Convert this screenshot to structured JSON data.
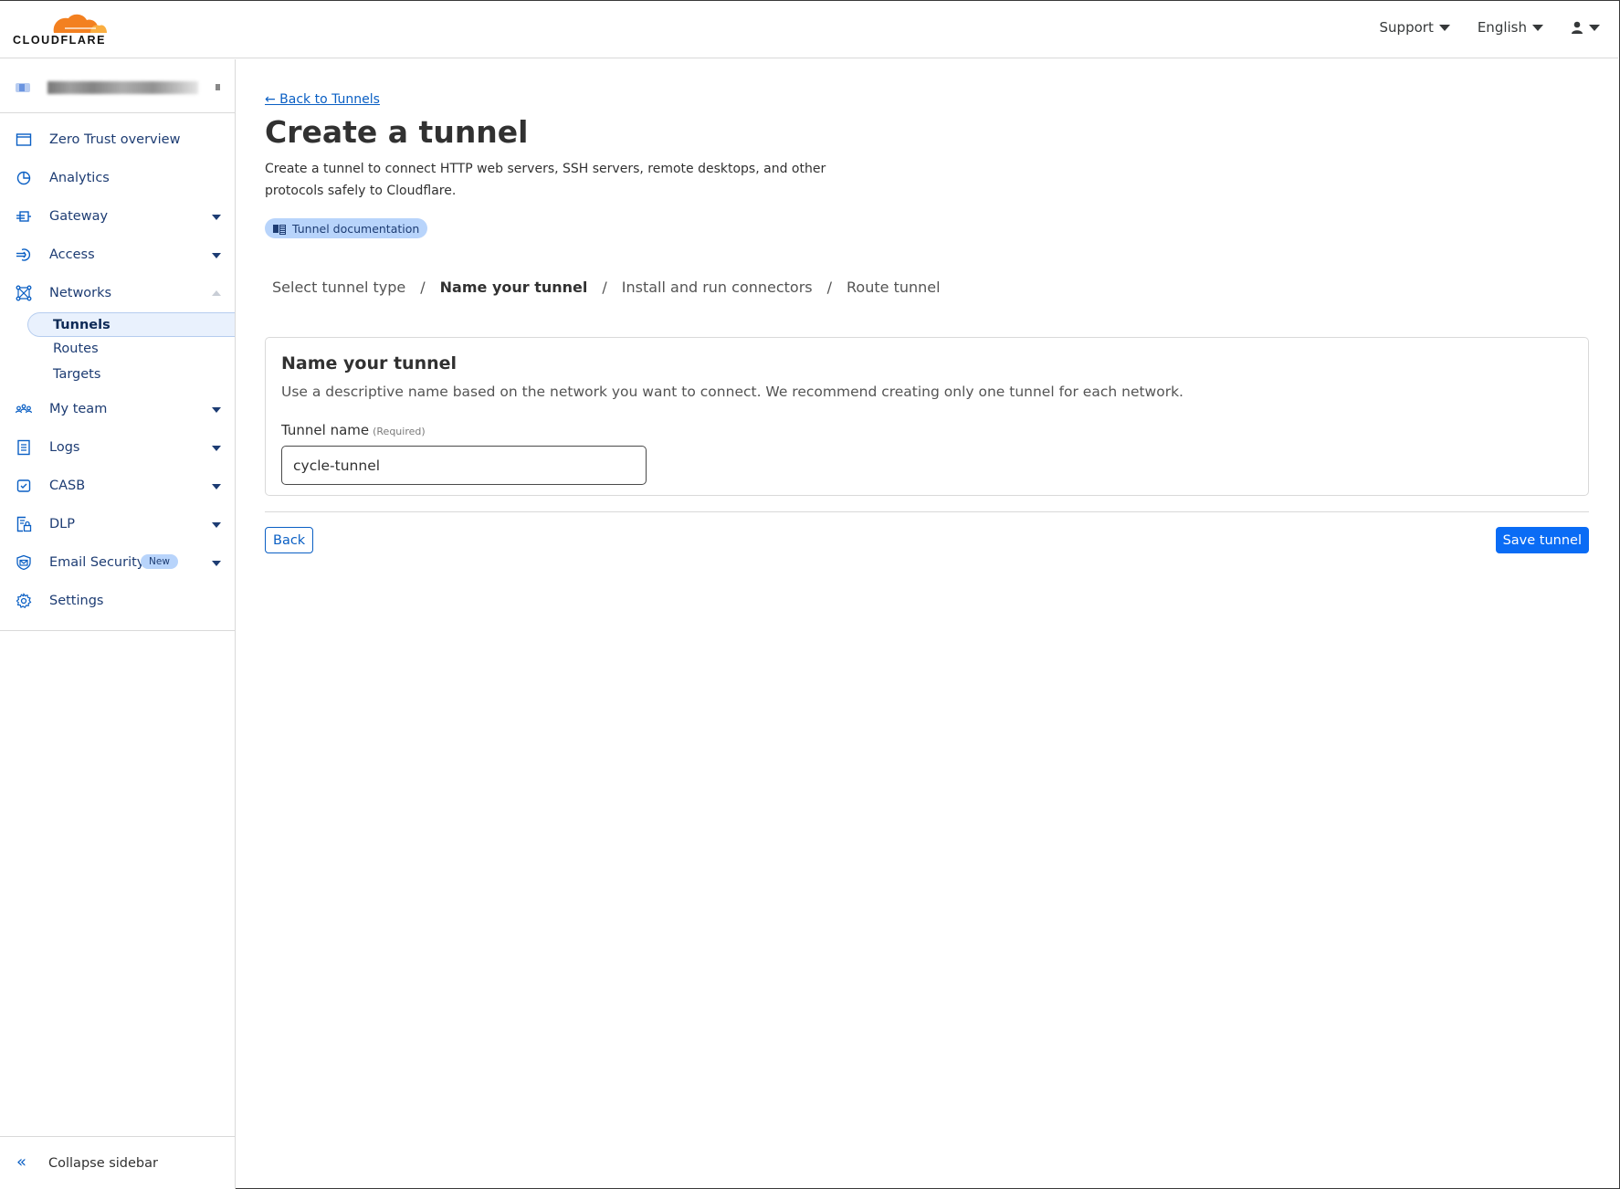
{
  "header": {
    "brand": "CLOUDFLARE",
    "brand_color": "#f38020",
    "nav": [
      {
        "label": "Support",
        "icon": "caret-down-icon"
      },
      {
        "label": "English",
        "icon": "caret-down-icon"
      },
      {
        "label": "",
        "icon": "user-icon"
      }
    ]
  },
  "sidebar": {
    "account_name_blurred": true,
    "items": [
      {
        "label": "Zero Trust overview",
        "icon": "browser-window-icon",
        "expandable": false
      },
      {
        "label": "Analytics",
        "icon": "pie-chart-icon",
        "expandable": false
      },
      {
        "label": "Gateway",
        "icon": "gateway-icon",
        "expandable": true
      },
      {
        "label": "Access",
        "icon": "access-icon",
        "expandable": true
      },
      {
        "label": "Networks",
        "icon": "network-icon",
        "expandable": true,
        "expanded": true,
        "children": [
          {
            "label": "Tunnels",
            "active": true
          },
          {
            "label": "Routes",
            "active": false
          },
          {
            "label": "Targets",
            "active": false
          }
        ]
      },
      {
        "label": "My team",
        "icon": "team-icon",
        "expandable": true
      },
      {
        "label": "Logs",
        "icon": "logs-icon",
        "expandable": true
      },
      {
        "label": "CASB",
        "icon": "casb-icon",
        "expandable": true
      },
      {
        "label": "DLP",
        "icon": "dlp-icon",
        "expandable": true
      },
      {
        "label": "Email Security",
        "icon": "email-security-icon",
        "expandable": true,
        "badge": "New"
      },
      {
        "label": "Settings",
        "icon": "gear-icon",
        "expandable": false
      }
    ],
    "collapse_label": "Collapse sidebar"
  },
  "main": {
    "back_link": "← Back to Tunnels",
    "title": "Create a tunnel",
    "description": "Create a tunnel to connect HTTP web servers, SSH servers, remote desktops, and other protocols safely to Cloudflare.",
    "doc_badge": "Tunnel documentation",
    "steps": [
      {
        "label": "Select tunnel type",
        "current": false
      },
      {
        "label": "Name your tunnel",
        "current": true
      },
      {
        "label": "Install and run connectors",
        "current": false
      },
      {
        "label": "Route tunnel",
        "current": false
      }
    ],
    "step_separator": "/",
    "card": {
      "title": "Name your tunnel",
      "description": "Use a descriptive name based on the network you want to connect. We recommend creating only one tunnel for each network.",
      "field_label": "Tunnel name",
      "field_required": "(Required)",
      "field_value": "cycle-tunnel"
    },
    "back_button": "Back",
    "save_button": "Save tunnel"
  },
  "colors": {
    "accent": "#0a6cf5",
    "link": "#0a5fc4",
    "nav_text": "#1d3c73",
    "badge_bg": "#b8d4fb"
  }
}
